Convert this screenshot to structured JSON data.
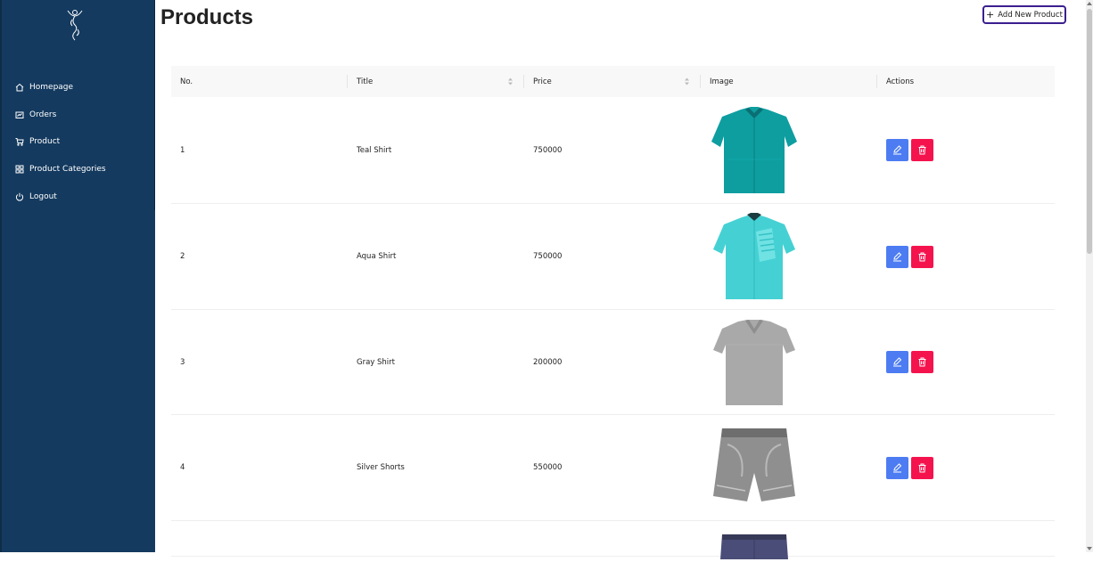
{
  "page": {
    "title": "Products"
  },
  "toolbar": {
    "add_label": "Add New Product"
  },
  "sidebar": {
    "items": [
      {
        "label": "Homepage",
        "icon": "home-icon"
      },
      {
        "label": "Orders",
        "icon": "orders-icon"
      },
      {
        "label": "Product",
        "icon": "cart-icon"
      },
      {
        "label": "Product Categories",
        "icon": "grid-icon"
      },
      {
        "label": "Logout",
        "icon": "power-icon"
      }
    ]
  },
  "table": {
    "columns": [
      "No.",
      "Title",
      "Price",
      "Image",
      "Actions"
    ],
    "rows": [
      {
        "no": "1",
        "title": "Teal Shirt",
        "price": "750000",
        "image": "teal-shirt-image"
      },
      {
        "no": "2",
        "title": "Aqua Shirt",
        "price": "750000",
        "image": "aqua-shirt-image"
      },
      {
        "no": "3",
        "title": "Gray Shirt",
        "price": "200000",
        "image": "gray-shirt-image"
      },
      {
        "no": "4",
        "title": "Silver Shorts",
        "price": "550000",
        "image": "silver-shorts-image"
      }
    ]
  },
  "colors": {
    "sidebar": "#143a5f",
    "edit_button": "#4d7cf2",
    "delete_button": "#f5134e",
    "add_button_border": "#3b1f8f"
  }
}
